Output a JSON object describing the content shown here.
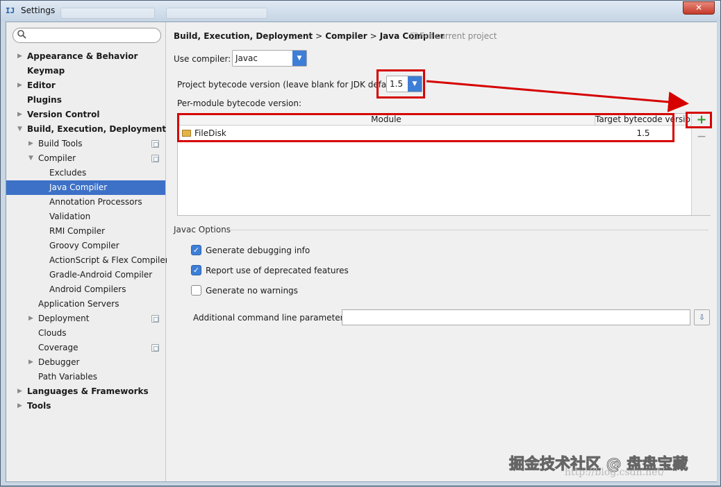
{
  "window": {
    "title": "Settings",
    "close_glyph": "✕",
    "app_icon": "intellij-idea-icon"
  },
  "search": {
    "placeholder": "",
    "value": ""
  },
  "sidebar": {
    "items": [
      {
        "label": "Appearance & Behavior",
        "bold": true,
        "arrow": "right",
        "indent": 0
      },
      {
        "label": "Keymap",
        "bold": true,
        "arrow": "",
        "indent": 0
      },
      {
        "label": "Editor",
        "bold": true,
        "arrow": "right",
        "indent": 0
      },
      {
        "label": "Plugins",
        "bold": true,
        "arrow": "",
        "indent": 0
      },
      {
        "label": "Version Control",
        "bold": true,
        "arrow": "right",
        "indent": 0
      },
      {
        "label": "Build, Execution, Deployment",
        "bold": true,
        "arrow": "down",
        "indent": 0
      },
      {
        "label": "Build Tools",
        "bold": false,
        "arrow": "right",
        "indent": 1,
        "project_icon": true
      },
      {
        "label": "Compiler",
        "bold": false,
        "arrow": "down",
        "indent": 1,
        "project_icon": true
      },
      {
        "label": "Excludes",
        "bold": false,
        "arrow": "",
        "indent": 2
      },
      {
        "label": "Java Compiler",
        "bold": false,
        "arrow": "",
        "indent": 2,
        "selected": true
      },
      {
        "label": "Annotation Processors",
        "bold": false,
        "arrow": "",
        "indent": 2
      },
      {
        "label": "Validation",
        "bold": false,
        "arrow": "",
        "indent": 2
      },
      {
        "label": "RMI Compiler",
        "bold": false,
        "arrow": "",
        "indent": 2
      },
      {
        "label": "Groovy Compiler",
        "bold": false,
        "arrow": "",
        "indent": 2
      },
      {
        "label": "ActionScript & Flex Compiler",
        "bold": false,
        "arrow": "",
        "indent": 2
      },
      {
        "label": "Gradle-Android Compiler",
        "bold": false,
        "arrow": "",
        "indent": 2
      },
      {
        "label": "Android Compilers",
        "bold": false,
        "arrow": "",
        "indent": 2
      },
      {
        "label": "Application Servers",
        "bold": false,
        "arrow": "",
        "indent": 1
      },
      {
        "label": "Deployment",
        "bold": false,
        "arrow": "right",
        "indent": 1,
        "project_icon": true
      },
      {
        "label": "Clouds",
        "bold": false,
        "arrow": "",
        "indent": 1
      },
      {
        "label": "Coverage",
        "bold": false,
        "arrow": "",
        "indent": 1,
        "project_icon": true
      },
      {
        "label": "Debugger",
        "bold": false,
        "arrow": "right",
        "indent": 1
      },
      {
        "label": "Path Variables",
        "bold": false,
        "arrow": "",
        "indent": 1
      },
      {
        "label": "Languages & Frameworks",
        "bold": true,
        "arrow": "right",
        "indent": 0
      },
      {
        "label": "Tools",
        "bold": true,
        "arrow": "right",
        "indent": 0
      }
    ]
  },
  "main": {
    "breadcrumb": [
      "Build, Execution, Deployment",
      "Compiler",
      "Java Compiler"
    ],
    "breadcrumb_sep": ">",
    "for_current_project": "For current project",
    "use_compiler_label": "Use compiler:",
    "use_compiler_value": "Javac",
    "bytecode_label": "Project bytecode version (leave blank for JDK default):",
    "bytecode_value": "1.5",
    "per_module_label": "Per-module bytecode version:",
    "table": {
      "columns": [
        "Module",
        "Target bytecode version"
      ],
      "rows": [
        {
          "module": "FileDisk",
          "version": "1.5"
        }
      ],
      "add_glyph": "+",
      "remove_glyph": "—"
    },
    "javac_options_title": "Javac Options",
    "options": [
      {
        "label": "Generate debugging info",
        "checked": true
      },
      {
        "label": "Report use of deprecated features",
        "checked": true
      },
      {
        "label": "Generate no warnings",
        "checked": false
      }
    ],
    "additional_params_label": "Additional command line parameters:",
    "additional_params_value": ""
  },
  "annotation": {
    "color": "#d60000"
  },
  "watermark": {
    "text": "掘金技术社区 @ 盘盘宝藏",
    "url": "http://blog.csdn.net/"
  },
  "colors": {
    "accent": "#3d7ed6",
    "selection": "#3d71c7",
    "add_green": "#2e9b2e"
  }
}
